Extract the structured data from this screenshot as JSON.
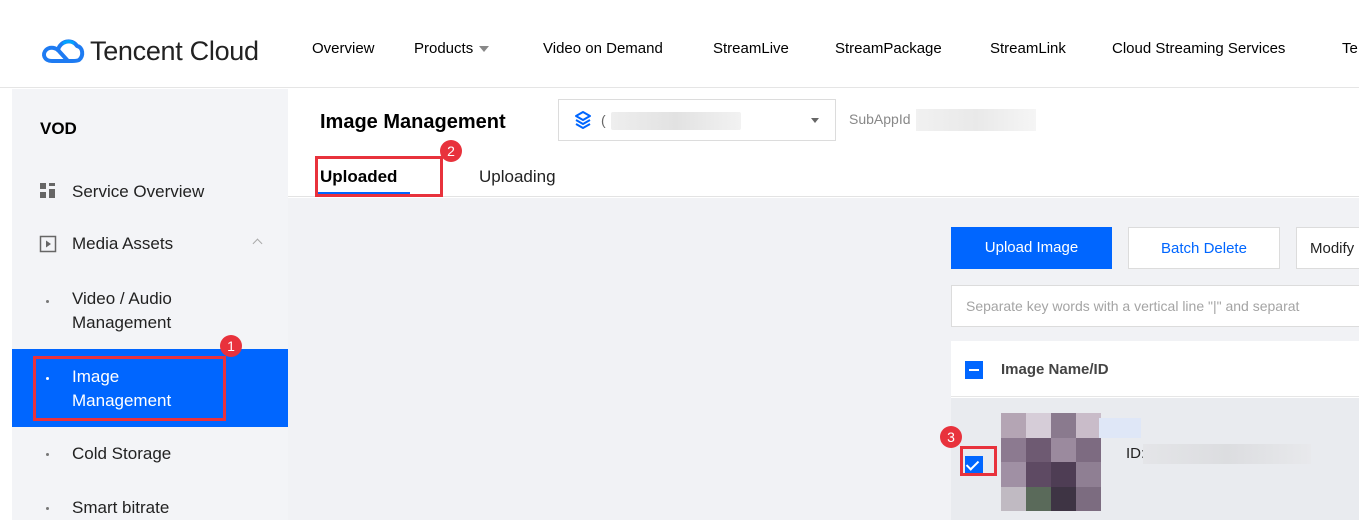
{
  "brand": {
    "name": "Tencent Cloud"
  },
  "nav": [
    {
      "label": "Overview"
    },
    {
      "label": "Products"
    },
    {
      "label": "Video on Demand"
    },
    {
      "label": "StreamLive"
    },
    {
      "label": "StreamPackage"
    },
    {
      "label": "StreamLink"
    },
    {
      "label": "Cloud Streaming Services"
    },
    {
      "label": "Te"
    }
  ],
  "sidebar": {
    "title": "VOD",
    "items": [
      {
        "label": "Service Overview",
        "icon": "grid-icon"
      },
      {
        "label": "Media Assets",
        "icon": "media-play-icon"
      },
      {
        "label": "Video / Audio Management"
      },
      {
        "label": "Image Management"
      },
      {
        "label": "Cold Storage"
      },
      {
        "label": "Smart bitrate"
      }
    ]
  },
  "header": {
    "title": "Image Management",
    "app_select_prefix": "(",
    "subapp_label": "SubAppId"
  },
  "tabs": [
    {
      "label": "Uploaded",
      "active": true
    },
    {
      "label": "Uploading",
      "active": false
    }
  ],
  "toolbar": {
    "upload_label": "Upload Image",
    "batch_delete_label": "Batch Delete",
    "modify_label": "Modify"
  },
  "search": {
    "placeholder": "Separate key words with a vertical line \"|\" and separat"
  },
  "table": {
    "header_name": "Image Name/ID",
    "row": {
      "id_prefix": "ID:"
    }
  },
  "annotations": {
    "step1": "1",
    "step2": "2",
    "step3": "3"
  },
  "colors": {
    "primary": "#0066ff",
    "annotation": "#e8323c",
    "sidebar_bg": "#f3f4f7",
    "content_bg": "#f1f2f5"
  }
}
